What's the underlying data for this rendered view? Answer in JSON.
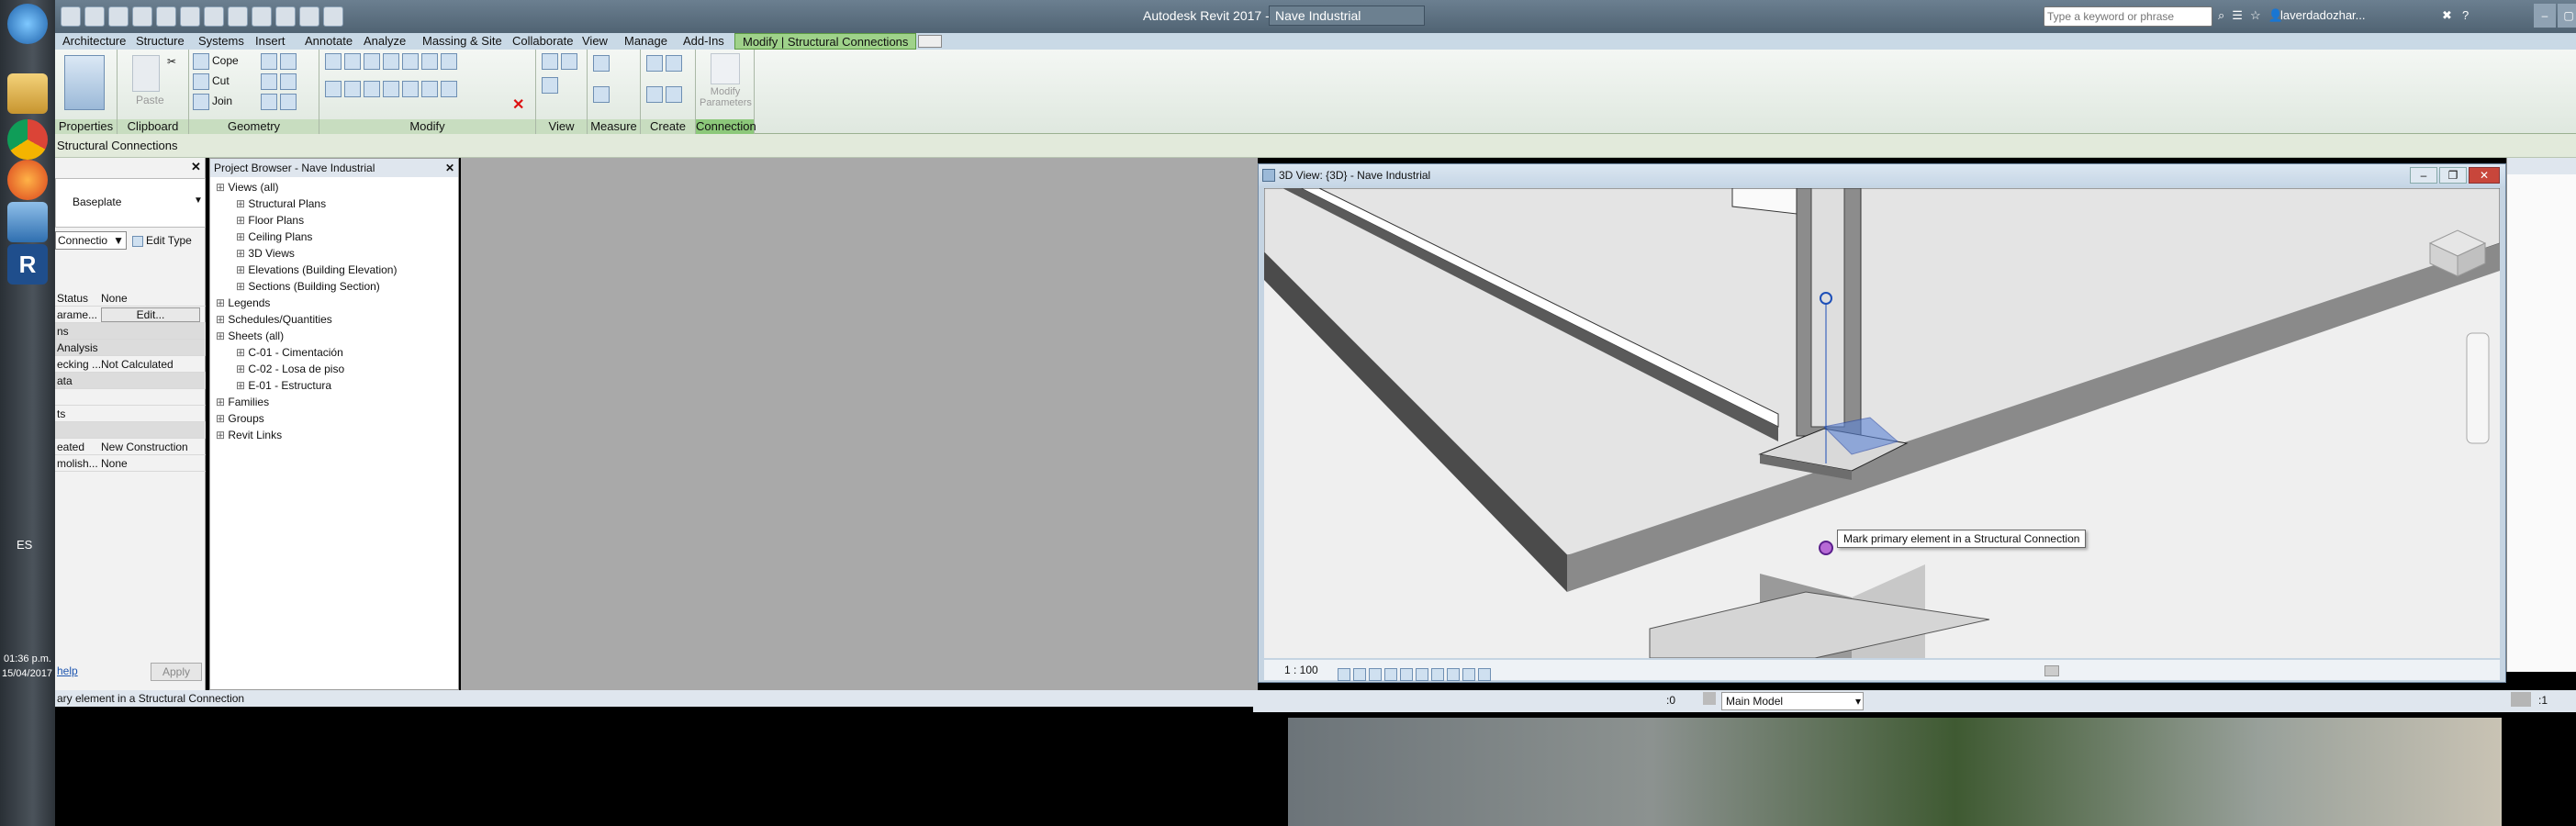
{
  "titlebar": {
    "app_title": "Autodesk Revit 2017 -",
    "doc_title": "Nave Industrial",
    "search_placeholder": "Type a keyword or phrase",
    "user": "laverdadozhar..."
  },
  "ribbon_tabs": [
    "Architecture",
    "Structure",
    "Systems",
    "Insert",
    "Annotate",
    "Analyze",
    "Massing & Site",
    "Collaborate",
    "View",
    "Manage",
    "Add-Ins",
    "Modify | Structural Connections"
  ],
  "ribbon": {
    "properties": {
      "title": "Properties"
    },
    "clipboard": {
      "title": "Clipboard",
      "paste": "Paste"
    },
    "geometry": {
      "title": "Geometry",
      "cope": "Cope",
      "cut": "Cut",
      "join": "Join"
    },
    "modify": {
      "title": "Modify"
    },
    "view": {
      "title": "View"
    },
    "measure": {
      "title": "Measure"
    },
    "create": {
      "title": "Create"
    },
    "connection": {
      "title": "Connection",
      "modify_parameters": "Modify Parameters"
    }
  },
  "context_bar": {
    "label": "Structural Connections"
  },
  "properties_panel": {
    "type_name": "Baseplate",
    "filter": "Connectio",
    "edit_type": "Edit Type",
    "rows": [
      {
        "k": "Status",
        "v": "None"
      },
      {
        "k": "arame...",
        "v": "Edit..."
      },
      {
        "k": "ns",
        "v": ""
      },
      {
        "k": "Analysis",
        "v": ""
      },
      {
        "k": "ecking ...",
        "v": "Not Calculated"
      },
      {
        "k": "ata",
        "v": ""
      },
      {
        "k": "",
        "v": ""
      },
      {
        "k": "ts",
        "v": ""
      },
      {
        "k": "",
        "v": ""
      },
      {
        "k": "eated",
        "v": "New Construction"
      },
      {
        "k": "molish...",
        "v": "None"
      }
    ],
    "help": "help",
    "apply": "Apply"
  },
  "project_browser": {
    "title": "Project Browser - Nave Industrial",
    "items": [
      {
        "label": "Views (all)",
        "level": 0
      },
      {
        "label": "Structural Plans",
        "level": 1
      },
      {
        "label": "Floor Plans",
        "level": 1
      },
      {
        "label": "Ceiling Plans",
        "level": 1
      },
      {
        "label": "3D Views",
        "level": 1
      },
      {
        "label": "Elevations (Building Elevation)",
        "level": 1
      },
      {
        "label": "Sections (Building Section)",
        "level": 1
      },
      {
        "label": "Legends",
        "level": 0
      },
      {
        "label": "Schedules/Quantities",
        "level": 0
      },
      {
        "label": "Sheets (all)",
        "level": 0
      },
      {
        "label": "C-01 - Cimentación",
        "level": 1
      },
      {
        "label": "C-02 - Losa de piso",
        "level": 1
      },
      {
        "label": "E-01 - Estructura",
        "level": 1
      },
      {
        "label": "Families",
        "level": 0
      },
      {
        "label": "Groups",
        "level": 0
      },
      {
        "label": "Revit Links",
        "level": 0
      }
    ]
  },
  "view3d": {
    "title": "3D View: {3D} - Nave Industrial",
    "tooltip": "Mark primary element in a Structural Connection",
    "scale": "1 : 100"
  },
  "taskbar": {
    "lang": "ES",
    "time": "01:36 p.m.",
    "date": "15/04/2017"
  },
  "statusbar": {
    "text": "ary element in a Structural Connection",
    "workset": ":0",
    "model": "Main Model",
    "sel_count": ":1"
  }
}
